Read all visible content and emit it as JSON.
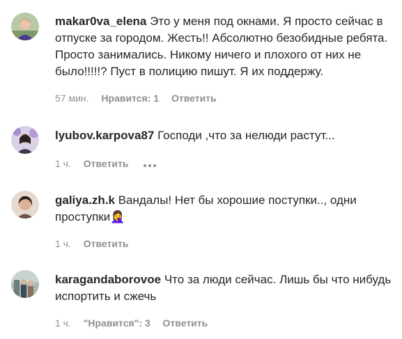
{
  "comments": [
    {
      "username": "makar0va_elena",
      "text": "Это у меня под окнами. Я просто сейчас в отпуске за городом. Жесть!! Абсолютно безобидные ребята. Просто занимались. Никому ничего и плохого от них не было!!!!!? Пуст в полицию пишут. Я их поддержу.",
      "time": "57 мин.",
      "likes": "Нравится: 1",
      "reply": "Ответить"
    },
    {
      "username": "lyubov.karpova87",
      "text": "Господи ,что за нелюди растут...",
      "time": "1 ч.",
      "reply": "Ответить"
    },
    {
      "username": "galiya.zh.k",
      "text": "Вандалы! Нет бы хорошие поступки.., одни проступки🤦‍♀️",
      "time": "1 ч.",
      "reply": "Ответить"
    },
    {
      "username": "karagandaborovoe",
      "text": "Что за люди сейчас. Лишь бы что нибудь испортить и сжечь",
      "time": "1 ч.",
      "likes": "\"Нравится\": 3",
      "reply": "Ответить"
    }
  ],
  "icons": {
    "more": "more-horizontal-icon"
  },
  "colors": {
    "text": "#262626",
    "meta": "#8e8e8e"
  }
}
